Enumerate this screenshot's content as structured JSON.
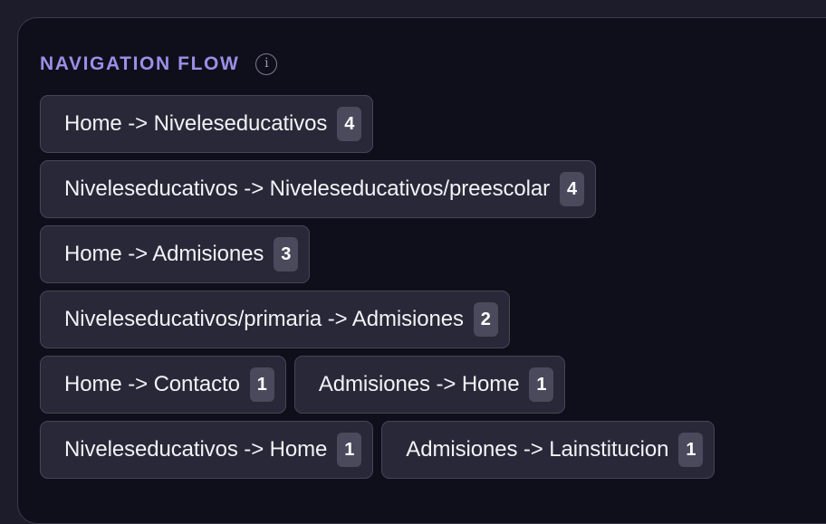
{
  "section": {
    "title": "NAVIGATION FLOW",
    "info_icon": "info-icon"
  },
  "rows": [
    [
      {
        "label": "Home -> Niveleseducativos",
        "count": "4"
      }
    ],
    [
      {
        "label": "Niveleseducativos -> Niveleseducativos/preescolar",
        "count": "4"
      }
    ],
    [
      {
        "label": "Home -> Admisiones",
        "count": "3"
      }
    ],
    [
      {
        "label": "Niveleseducativos/primaria -> Admisiones",
        "count": "2"
      }
    ],
    [
      {
        "label": "Home -> Contacto",
        "count": "1"
      },
      {
        "label": "Admisiones -> Home",
        "count": "1"
      }
    ],
    [
      {
        "label": "Niveleseducativos -> Home",
        "count": "1"
      },
      {
        "label": "Admisiones -> Lainstitucion",
        "count": "1"
      }
    ]
  ],
  "colors": {
    "accent": "#9b8fe6",
    "panel_bg": "#0f0f1c",
    "chip_bg": "#282838",
    "count_bg": "#4a4a5c"
  }
}
